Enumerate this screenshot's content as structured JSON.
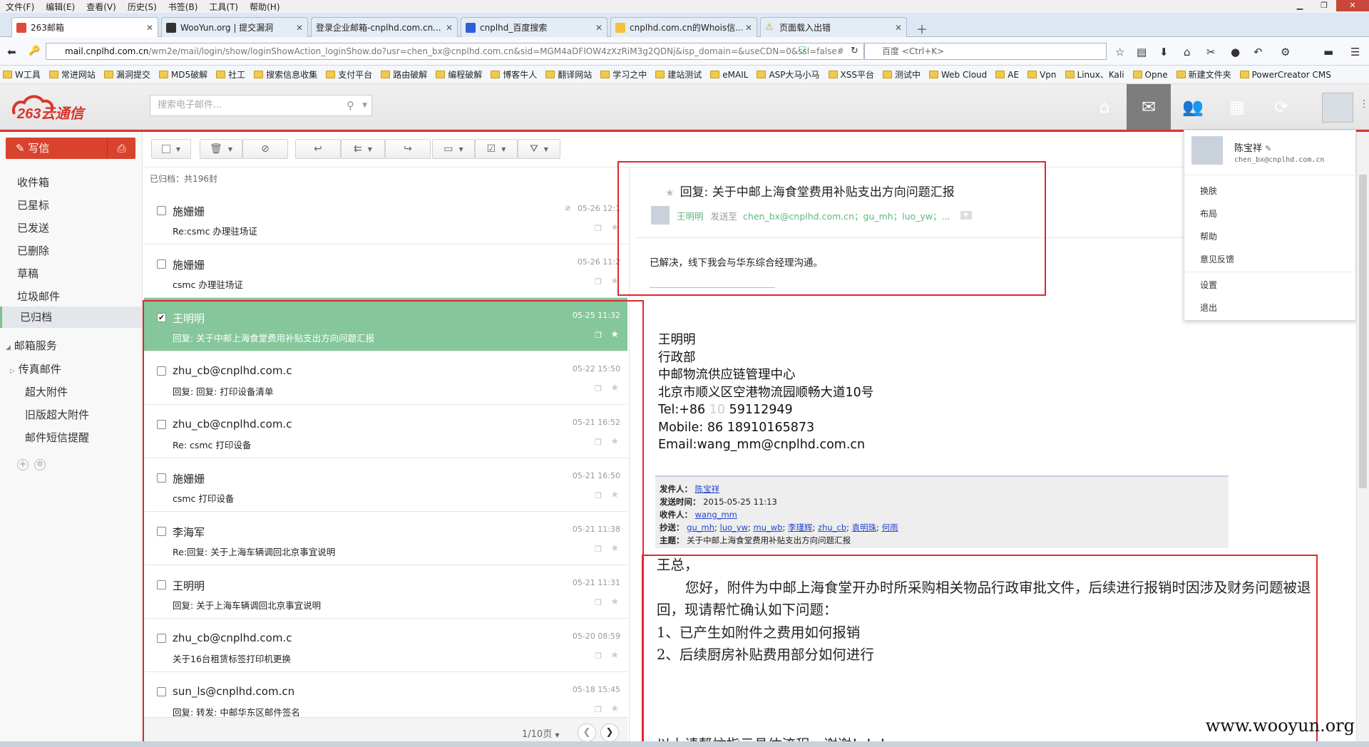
{
  "menubar": [
    "文件(F)",
    "编辑(E)",
    "查看(V)",
    "历史(S)",
    "书签(B)",
    "工具(T)",
    "帮助(H)"
  ],
  "tabs": [
    {
      "label": "263邮箱",
      "active": true
    },
    {
      "label": "WooYun.org | 提交漏洞"
    },
    {
      "label": "登录企业邮箱-cnplhd.com.cn..."
    },
    {
      "label": "cnplhd_百度搜索"
    },
    {
      "label": "cnplhd.com.cn的Whois信..."
    },
    {
      "label": "页面载入出错"
    }
  ],
  "url": {
    "host": "mail.cnplhd.com.cn",
    "path": "/wm2e/mail/login/show/loginShowAction_loginShow.do?usr=chen_bx@cnplhd.com.cn&sid=MGM4aDFIOW4zXzRiM3g2QDNj&isp_domain=&useCDN=0&ssl=false#"
  },
  "browser_search_placeholder": "百度 <Ctrl+K>",
  "bookmarks": [
    "W工具",
    "常进网站",
    "漏洞提交",
    "MD5破解",
    "社工",
    "搜索信息收集",
    "支付平台",
    "路由破解",
    "编程破解",
    "博客牛人",
    "翻译网站",
    "学习之中",
    "建站测试",
    "eMAIL",
    "ASP大马小马",
    "XSS平台",
    "测试中",
    "Web Cloud",
    "AE",
    "Vpn",
    "Linux、Kali",
    "Opne",
    "新建文件夹",
    "PowerCreator CMS"
  ],
  "app": {
    "logo_text": "263云通信",
    "search_placeholder": "搜索电子邮件..."
  },
  "sidebar": {
    "write": "写信",
    "items": [
      "收件箱",
      "已星标",
      "已发送",
      "已删除",
      "草稿",
      "垃圾邮件",
      "已归档"
    ],
    "selected": "已归档",
    "services_label": "邮箱服务",
    "service_items": [
      "传真邮件",
      "超大附件",
      "旧版超大附件",
      "邮件短信提醒"
    ]
  },
  "list": {
    "header": "已归档：共196封",
    "rows": [
      {
        "from": "施姗姗",
        "subject": "Re:csmc 办理驻场证",
        "date": "05-26 12:1",
        "attach": true
      },
      {
        "from": "施姗姗",
        "subject": "csmc 办理驻场证",
        "date": "05-26 11:2"
      },
      {
        "from": "王明明",
        "subject": "回复: 关于中邮上海食堂费用补贴支出方向问题汇报",
        "date": "05-25 11:32",
        "selected": true
      },
      {
        "from": "zhu_cb@cnplhd.com.c",
        "subject": "回复: 回复: 打印设备清单",
        "date": "05-22 15:50"
      },
      {
        "from": "zhu_cb@cnplhd.com.c",
        "subject": "Re: csmc 打印设备",
        "date": "05-21 16:52"
      },
      {
        "from": "施姗姗",
        "subject": "csmc 打印设备",
        "date": "05-21 16:50"
      },
      {
        "from": "李海军",
        "subject": "Re:回复: 关于上海车辆调回北京事宜说明",
        "date": "05-21 11:38"
      },
      {
        "from": "王明明",
        "subject": "回复: 关于上海车辆调回北京事宜说明",
        "date": "05-21 11:31"
      },
      {
        "from": "zhu_cb@cnplhd.com.c",
        "subject": "关于16台租赁标签打印机更换",
        "date": "05-20 08:59"
      },
      {
        "from": "sun_ls@cnplhd.com.cn",
        "subject": "回复: 转发: 中邮华东区邮件签名",
        "date": "05-18 15:45"
      }
    ],
    "pager": "1/10页"
  },
  "reader": {
    "title": "回复: 关于中邮上海食堂费用补贴支出方向问题汇报",
    "sender": "王明明",
    "sent_to_label": "发送至",
    "recipients": "chen_bx@cnplhd.com.cn；gu_mh；luo_yw；...",
    "body_line": "已解决，线下我会与华东综合经理沟通。",
    "signature": {
      "name": "王明明",
      "dept": "行政部",
      "org": "中邮物流供应链管理中心",
      "addr": "北京市顺义区空港物流园顺畅大道10号",
      "tel_prefix": "Tel:+86 ",
      "tel_area": "10",
      "tel_num": " 59112949",
      "mobile": "Mobile: 86 18910165873",
      "email": "Email:wang_mm@cnplhd.com.cn"
    },
    "quote": {
      "from_label": "发件人：",
      "from": "陈宝祥",
      "time_label": "发送时间：",
      "time": "2015-05-25 11:13",
      "to_label": "收件人：",
      "to": "wang_mm",
      "cc_label": "抄送：",
      "cc": [
        "gu_mh",
        "luo_yw",
        "mu_wb",
        "李瑾辉",
        "zhu_cb",
        "袁明珠",
        "何雨"
      ],
      "subject_label": "主题：",
      "subject": "关于中邮上海食堂费用补贴支出方向问题汇报"
    },
    "quoted_body": {
      "greeting": "王总，",
      "p1": "您好，附件为中邮上海食堂开办时所采购相关物品行政审批文件，后续进行报销时因涉及财务问题被退回，现请帮忙确认如下问题：",
      "q1": "1、已产生如附件之费用如何报销",
      "q2": "2、后续厨房补贴费用部分如何进行",
      "closing": "以上请帮忙指示具体流程，谢谢！！！"
    }
  },
  "user_menu": {
    "name": "陈宝祥",
    "email": "chen_bx@cnplhd.com.cn",
    "items": [
      "换肤",
      "布局",
      "帮助",
      "意见反馈",
      "设置",
      "退出"
    ]
  },
  "watermark": "www.wooyun.org"
}
